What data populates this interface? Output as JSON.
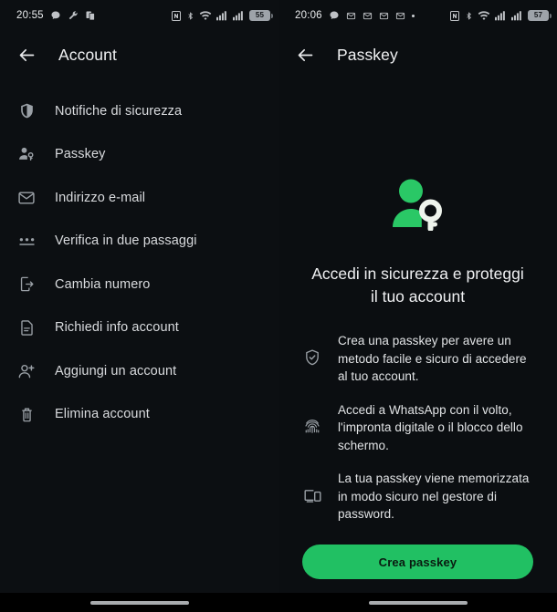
{
  "left_panel": {
    "status_bar": {
      "time": "20:55",
      "left_icons": [
        "chat-bubble-icon",
        "wrench-icon",
        "copy-icon"
      ],
      "right_icons": [
        "nfc-icon",
        "bluetooth-icon",
        "wifi-icon",
        "signal-sim1-icon",
        "signal-sim2-icon"
      ],
      "battery_level": "55"
    },
    "appbar": {
      "back_label": "back-arrow",
      "title": "Account"
    },
    "menu_items": [
      {
        "icon": "shield-icon",
        "label": "Notifiche di sicurezza"
      },
      {
        "icon": "person-key-icon",
        "label": "Passkey"
      },
      {
        "icon": "envelope-icon",
        "label": "Indirizzo e-mail"
      },
      {
        "icon": "two-step-dots-icon",
        "label": "Verifica in due passaggi"
      },
      {
        "icon": "phone-arrow-icon",
        "label": "Cambia numero"
      },
      {
        "icon": "document-icon",
        "label": "Richiedi info account"
      },
      {
        "icon": "person-add-icon",
        "label": "Aggiungi un account"
      },
      {
        "icon": "trash-icon",
        "label": "Elimina account"
      }
    ]
  },
  "right_panel": {
    "status_bar": {
      "time": "20:06",
      "left_icons": [
        "chat-bubble-icon",
        "mail-icon",
        "mail-icon",
        "mail-icon",
        "mail-icon",
        "dot-icon"
      ],
      "right_icons": [
        "nfc-icon",
        "bluetooth-icon",
        "wifi-icon",
        "signal-sim1-icon",
        "signal-sim2-icon"
      ],
      "battery_level": "57"
    },
    "appbar": {
      "back_label": "back-arrow",
      "title": "Passkey"
    },
    "hero_icon": "person-with-key-illustration",
    "headline": "Accedi in sicurezza e proteggi il tuo account",
    "bullets": [
      {
        "icon": "shield-check-icon",
        "text": "Crea una passkey per avere un metodo facile e sicuro di accedere al tuo account."
      },
      {
        "icon": "fingerprint-icon",
        "text": "Accedi a WhatsApp con il volto, l'impronta digitale o il blocco dello schermo."
      },
      {
        "icon": "devices-icon",
        "text": "La tua passkey viene memorizzata in modo sicuro nel gestore di password."
      }
    ],
    "cta_label": "Crea passkey"
  },
  "theme": {
    "background": "#0b0e11",
    "accent_green": "#21c063",
    "hero_green": "#2ac866",
    "text_primary": "#f0f1f3",
    "text_secondary": "#d9dbde",
    "icon_grey": "#9aa0a6"
  }
}
